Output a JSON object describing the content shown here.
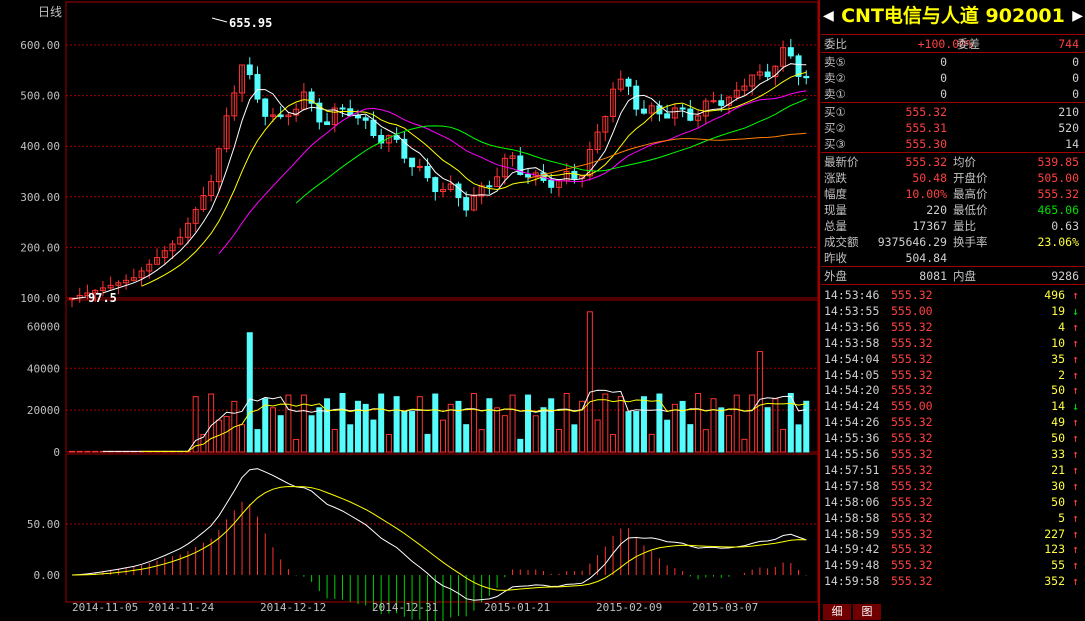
{
  "period_label": "日线",
  "price_axis": [
    "600.00",
    "500.00",
    "400.00",
    "300.00",
    "200.00",
    "100.00"
  ],
  "volume_axis": [
    "60000",
    "40000",
    "20000",
    "0"
  ],
  "macd_axis": [
    "50.00",
    "0.00"
  ],
  "date_labels": [
    "2014-11-05",
    "2014-11-24",
    "2014-12-12",
    "2014-12-31",
    "2015-01-21",
    "2015-02-09",
    "2015-03-07"
  ],
  "high_label": "655.95",
  "low_label": "97.5",
  "stock": {
    "name": "CNT电信与人道",
    "code": "902001"
  },
  "orderbook": {
    "ratio_label": "委比",
    "ratio_value": "+100.00%",
    "diff_label": "委差",
    "diff_value": "744",
    "asks": [
      {
        "label": "卖⑤",
        "price": "0",
        "vol": "0"
      },
      {
        "label": "卖②",
        "price": "0",
        "vol": "0"
      },
      {
        "label": "卖①",
        "price": "0",
        "vol": "0"
      }
    ],
    "bids": [
      {
        "label": "买①",
        "price": "555.32",
        "vol": "210"
      },
      {
        "label": "买②",
        "price": "555.31",
        "vol": "520"
      },
      {
        "label": "买③",
        "price": "555.30",
        "vol": "14"
      }
    ]
  },
  "quote": [
    {
      "l1": "最新价",
      "v1": "555.32",
      "c1": "red",
      "l2": "均价",
      "v2": "539.85",
      "c2": "red"
    },
    {
      "l1": "涨跌",
      "v1": "50.48",
      "c1": "red",
      "l2": "开盘价",
      "v2": "505.00",
      "c2": "red"
    },
    {
      "l1": "幅度",
      "v1": "10.00%",
      "c1": "red",
      "l2": "最高价",
      "v2": "555.32",
      "c2": "red"
    },
    {
      "l1": "现量",
      "v1": "220",
      "c1": "white",
      "l2": "最低价",
      "v2": "465.06",
      "c2": "green"
    },
    {
      "l1": "总量",
      "v1": "17367",
      "c1": "white",
      "l2": "量比",
      "v2": "0.63",
      "c2": "white"
    },
    {
      "l1": "成交额",
      "v1": "9375646.29",
      "c1": "white",
      "l2": "换手率",
      "v2": "23.06%",
      "c2": "yellow"
    },
    {
      "l1": "昨收",
      "v1": "504.84",
      "c1": "white",
      "l2": "",
      "v2": "",
      "c2": "white"
    }
  ],
  "outer": {
    "l1": "外盘",
    "v1": "8081",
    "l2": "内盘",
    "v2": "9286"
  },
  "ticks": [
    {
      "t": "14:53:46",
      "p": "555.32",
      "v": "496",
      "d": "↑"
    },
    {
      "t": "14:53:55",
      "p": "555.00",
      "v": "19",
      "d": "↓"
    },
    {
      "t": "14:53:56",
      "p": "555.32",
      "v": "4",
      "d": "↑"
    },
    {
      "t": "14:53:58",
      "p": "555.32",
      "v": "10",
      "d": "↑"
    },
    {
      "t": "14:54:04",
      "p": "555.32",
      "v": "35",
      "d": "↑"
    },
    {
      "t": "14:54:05",
      "p": "555.32",
      "v": "2",
      "d": "↑"
    },
    {
      "t": "14:54:20",
      "p": "555.32",
      "v": "50",
      "d": "↑"
    },
    {
      "t": "14:54:24",
      "p": "555.00",
      "v": "14",
      "d": "↓"
    },
    {
      "t": "14:54:26",
      "p": "555.32",
      "v": "49",
      "d": "↑"
    },
    {
      "t": "14:55:36",
      "p": "555.32",
      "v": "50",
      "d": "↑"
    },
    {
      "t": "14:55:56",
      "p": "555.32",
      "v": "33",
      "d": "↑"
    },
    {
      "t": "14:57:51",
      "p": "555.32",
      "v": "21",
      "d": "↑"
    },
    {
      "t": "14:57:58",
      "p": "555.32",
      "v": "30",
      "d": "↑"
    },
    {
      "t": "14:58:06",
      "p": "555.32",
      "v": "50",
      "d": "↑"
    },
    {
      "t": "14:58:58",
      "p": "555.32",
      "v": "5",
      "d": "↑"
    },
    {
      "t": "14:58:59",
      "p": "555.32",
      "v": "227",
      "d": "↑"
    },
    {
      "t": "14:59:42",
      "p": "555.32",
      "v": "123",
      "d": "↑"
    },
    {
      "t": "14:59:48",
      "p": "555.32",
      "v": "55",
      "d": "↑"
    },
    {
      "t": "14:59:58",
      "p": "555.32",
      "v": "352",
      "d": "↑"
    }
  ],
  "tabs": [
    "细",
    "图"
  ],
  "colors": {
    "up": "#ff3232",
    "down": "#54fcfc",
    "grid": "#a00000",
    "ma5": "#ffffff",
    "ma10": "#ffff00",
    "ma20": "#ff00ff",
    "ma30": "#00ff00",
    "ma60": "#ff8000"
  }
}
